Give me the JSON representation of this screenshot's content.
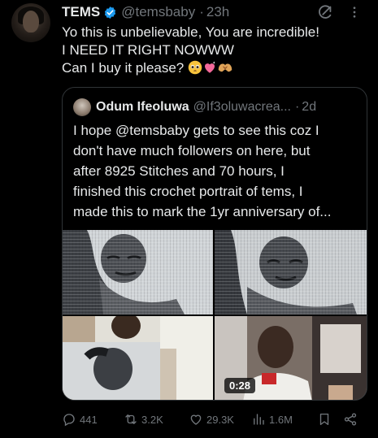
{
  "post": {
    "author_name": "TEMS",
    "author_handle": "@temsbaby",
    "time": "23h",
    "separator": "·",
    "text_lines": [
      "Yo this is unbelievable, You are incredible!",
      "I NEED IT RIGHT NOWWW",
      "Can I buy it please?"
    ],
    "emojis": [
      "pleading-face-emoji",
      "sparkling-heart-emoji",
      "heart-hands-emoji"
    ]
  },
  "quote": {
    "author_name": "Odum Ifeoluwa",
    "author_handle": "@If3oluwacrea...",
    "time": "2d",
    "separator": "·",
    "text_lines": [
      "I hope @temsbaby gets to see this coz I",
      "don't have much followers on here, but",
      "after 8925 Stitches and 70 hours, I",
      "finished this crochet portrait of tems, I",
      "made this to mark the 1yr anniversary of..."
    ],
    "video_duration": "0:28"
  },
  "actions": {
    "replies": "441",
    "reposts": "3.2K",
    "likes": "29.3K",
    "views": "1.6M"
  },
  "colors": {
    "background": "#000000",
    "text": "#e7e9ea",
    "muted": "#71767b",
    "verified_blue": "#1d9bf0",
    "border": "#2f3336"
  },
  "icons": [
    "grok-icon",
    "more-icon",
    "verified-badge-icon",
    "reply-icon",
    "repost-icon",
    "like-icon",
    "views-icon",
    "bookmark-icon",
    "share-icon"
  ]
}
